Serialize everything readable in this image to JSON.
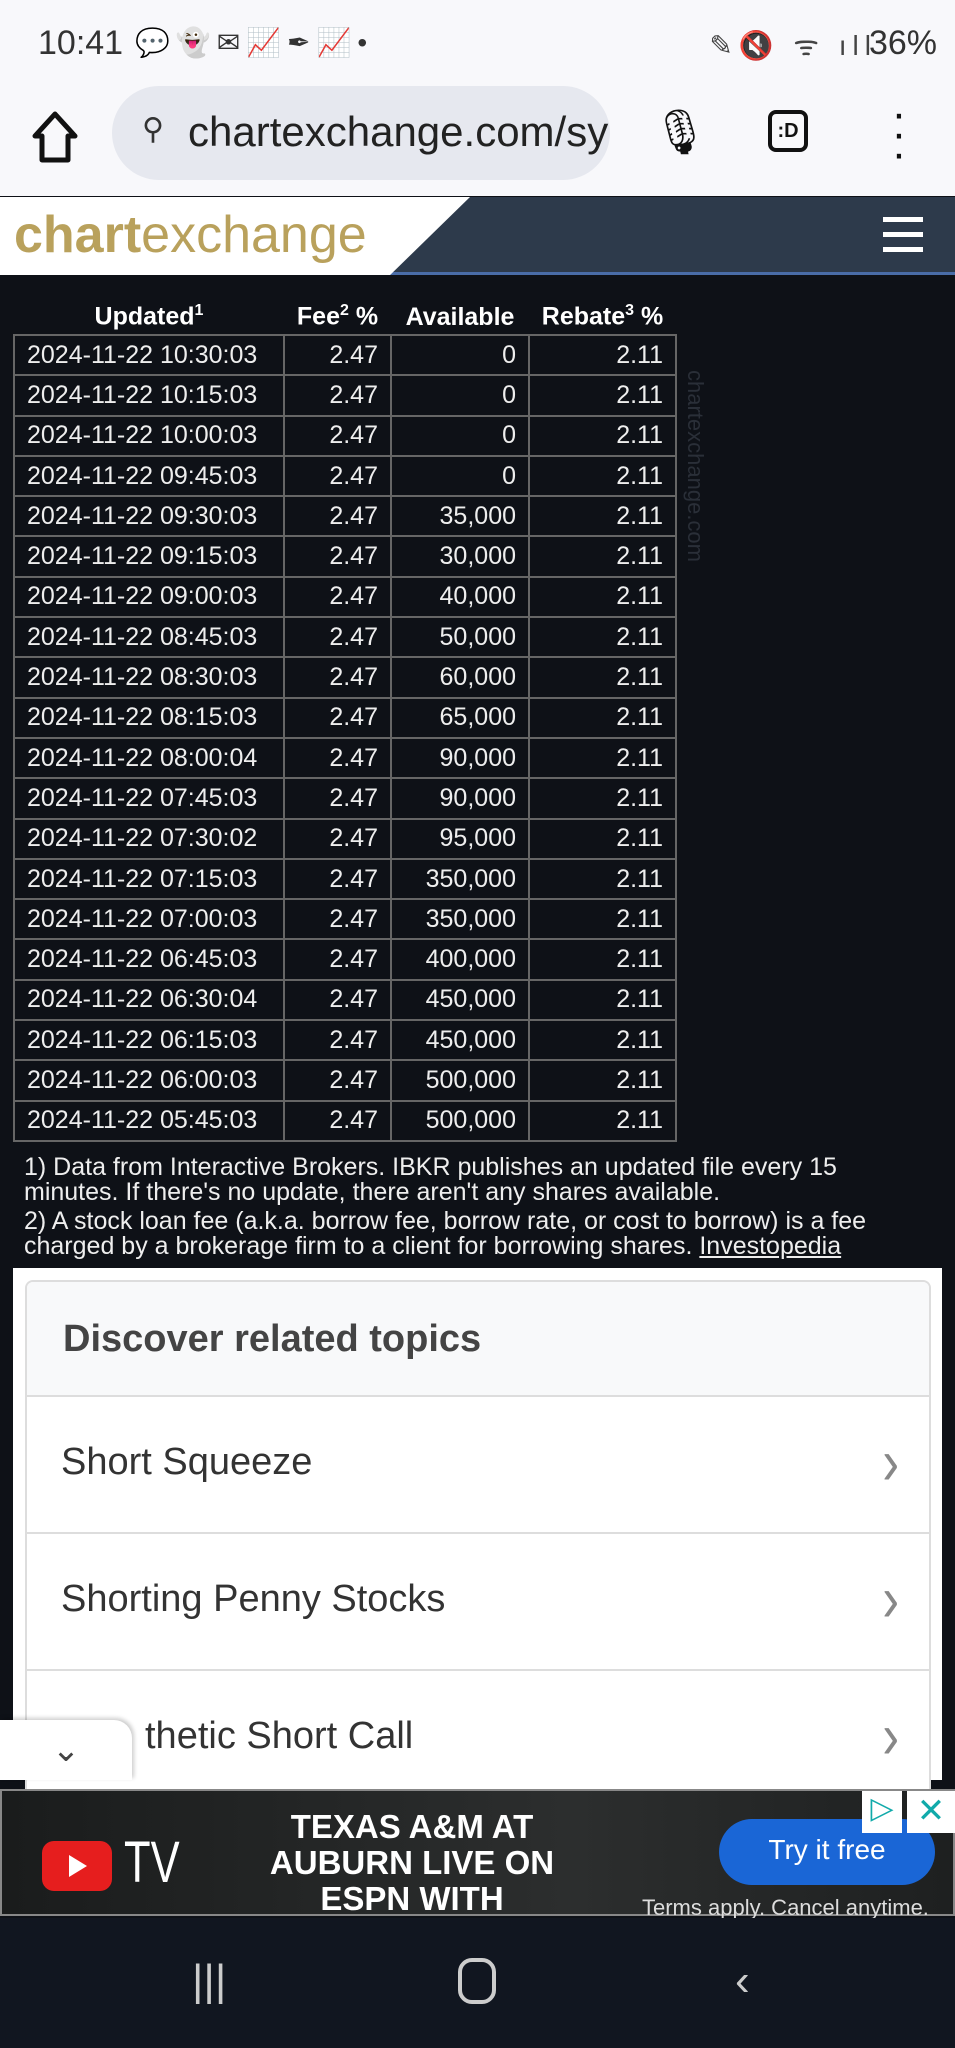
{
  "status_bar": {
    "time": "10:41",
    "battery": "36%"
  },
  "browser": {
    "url": "chartexchange.com/sy",
    "tabs_label": ":D"
  },
  "site": {
    "logo_bold": "chart",
    "logo_light": "exchange"
  },
  "table": {
    "headers": [
      {
        "label": "Updated",
        "sup": "1"
      },
      {
        "label": "Fee",
        "sup": "2",
        "suffix": " %"
      },
      {
        "label": "Available"
      },
      {
        "label": "Rebate",
        "sup": "3",
        "suffix": " %"
      }
    ],
    "rows": [
      [
        "2024-11-22 10:30:03",
        "2.47",
        "0",
        "2.11"
      ],
      [
        "2024-11-22 10:15:03",
        "2.47",
        "0",
        "2.11"
      ],
      [
        "2024-11-22 10:00:03",
        "2.47",
        "0",
        "2.11"
      ],
      [
        "2024-11-22 09:45:03",
        "2.47",
        "0",
        "2.11"
      ],
      [
        "2024-11-22 09:30:03",
        "2.47",
        "35,000",
        "2.11"
      ],
      [
        "2024-11-22 09:15:03",
        "2.47",
        "30,000",
        "2.11"
      ],
      [
        "2024-11-22 09:00:03",
        "2.47",
        "40,000",
        "2.11"
      ],
      [
        "2024-11-22 08:45:03",
        "2.47",
        "50,000",
        "2.11"
      ],
      [
        "2024-11-22 08:30:03",
        "2.47",
        "60,000",
        "2.11"
      ],
      [
        "2024-11-22 08:15:03",
        "2.47",
        "65,000",
        "2.11"
      ],
      [
        "2024-11-22 08:00:04",
        "2.47",
        "90,000",
        "2.11"
      ],
      [
        "2024-11-22 07:45:03",
        "2.47",
        "90,000",
        "2.11"
      ],
      [
        "2024-11-22 07:30:02",
        "2.47",
        "95,000",
        "2.11"
      ],
      [
        "2024-11-22 07:15:03",
        "2.47",
        "350,000",
        "2.11"
      ],
      [
        "2024-11-22 07:00:03",
        "2.47",
        "350,000",
        "2.11"
      ],
      [
        "2024-11-22 06:45:03",
        "2.47",
        "400,000",
        "2.11"
      ],
      [
        "2024-11-22 06:30:04",
        "2.47",
        "450,000",
        "2.11"
      ],
      [
        "2024-11-22 06:15:03",
        "2.47",
        "450,000",
        "2.11"
      ],
      [
        "2024-11-22 06:00:03",
        "2.47",
        "500,000",
        "2.11"
      ],
      [
        "2024-11-22 05:45:03",
        "2.47",
        "500,000",
        "2.11"
      ]
    ],
    "watermark": "chartexchange.com"
  },
  "notes": {
    "note1": "1) Data from Interactive Brokers. IBKR publishes an updated file every 15 minutes. If there's no update, there aren't any shares available.",
    "note2": "2) A stock loan fee (a.k.a. borrow fee, borrow rate, or cost to borrow) is a fee charged by a brokerage firm to a client for borrowing shares.",
    "note2_link": "Investopedia"
  },
  "related": {
    "title": "Discover related topics",
    "items": [
      "Short Squeeze",
      "Shorting Penny Stocks",
      "thetic Short Call"
    ]
  },
  "ad": {
    "brand": "TV",
    "headline": "TEXAS A&M AT AUBURN LIVE ON ESPN WITH YOUTUBE TV",
    "cta": "Try it free",
    "terms": "Terms apply. Cancel anytime."
  }
}
